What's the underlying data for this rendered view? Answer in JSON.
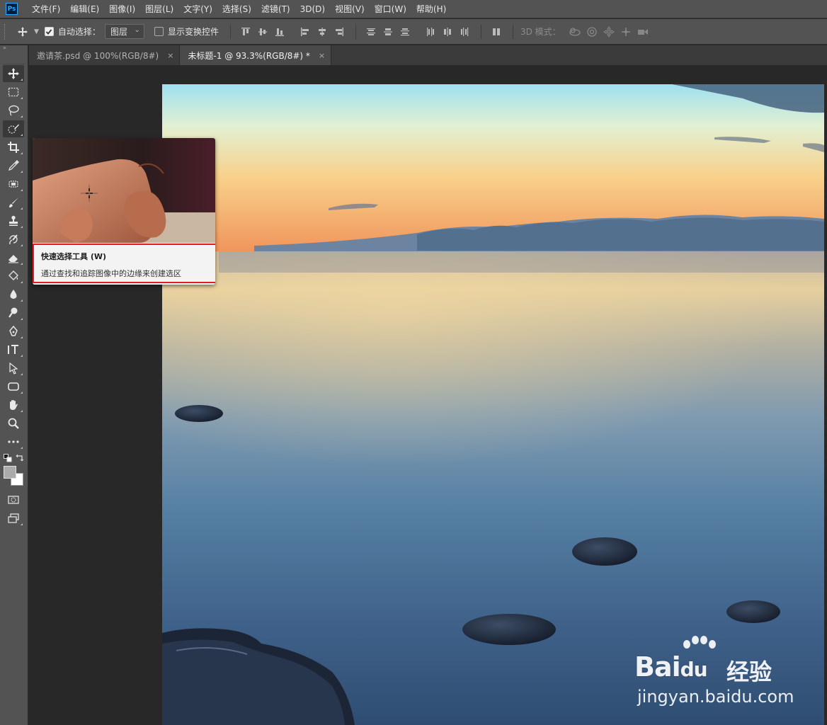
{
  "app": {
    "logo_text": "Ps"
  },
  "menu": [
    "文件(F)",
    "编辑(E)",
    "图像(I)",
    "图层(L)",
    "文字(Y)",
    "选择(S)",
    "滤镜(T)",
    "3D(D)",
    "视图(V)",
    "窗口(W)",
    "帮助(H)"
  ],
  "options": {
    "auto_select_label": "自动选择：",
    "auto_select_checked": true,
    "layer_select_value": "图层",
    "show_transform_label": "显示变换控件",
    "show_transform_checked": false,
    "mode_3d_label": "3D 模式："
  },
  "tabs": [
    {
      "label": "邀请茶.psd @ 100%(RGB/8#)",
      "close": "×",
      "active": false
    },
    {
      "label": "未标题-1 @ 93.3%(RGB/8#) *",
      "close": "×",
      "active": true
    }
  ],
  "tooltip": {
    "title": "快速选择工具 (W)",
    "description": "通过查找和追踪图像中的边缘来创建选区"
  },
  "watermark": {
    "brand": "Bai",
    "brand_suffix": "du",
    "product": "经验",
    "url": "jingyan.baidu.com"
  },
  "colors": {
    "ui_panel": "#535353",
    "workspace": "#282828",
    "highlight_border": "#e51c23"
  }
}
